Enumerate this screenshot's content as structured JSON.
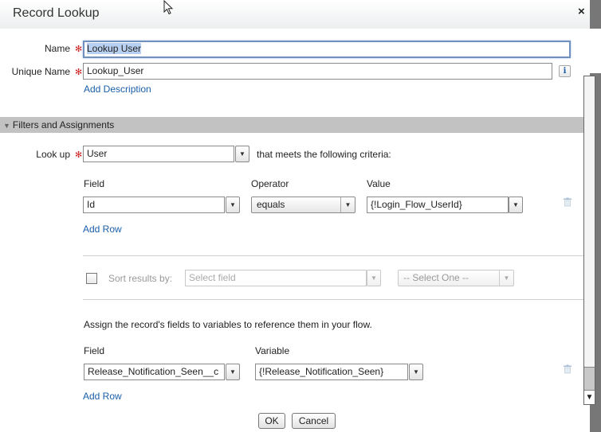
{
  "dialog": {
    "title": "Record Lookup",
    "close_icon": "×"
  },
  "form": {
    "name": {
      "label": "Name",
      "value": "Lookup User",
      "required": true
    },
    "unique_name": {
      "label": "Unique Name",
      "value": "Lookup_User",
      "required": true
    },
    "info_icon": "i",
    "add_description": "Add Description"
  },
  "section": {
    "title": "Filters and Assignments",
    "toggle_icon": "▼"
  },
  "lookup": {
    "label": "Look up",
    "value": "User",
    "suffix": "that meets the following criteria:"
  },
  "filters": {
    "headers": {
      "field": "Field",
      "operator": "Operator",
      "value": "Value"
    },
    "rows": [
      {
        "field": "Id",
        "operator": "equals",
        "value": "{!Login_Flow_UserId}"
      }
    ],
    "add_row": "Add Row"
  },
  "sort": {
    "label": "Sort results by:",
    "field_placeholder": "Select field",
    "order_value": "-- Select One --",
    "checked": false
  },
  "assignments": {
    "intro": "Assign the record's fields to variables to reference them in your flow.",
    "headers": {
      "field": "Field",
      "variable": "Variable"
    },
    "rows": [
      {
        "field": "Release_Notification_Seen__c",
        "variable": "{!Release_Notification_Seen}"
      }
    ],
    "add_row": "Add Row"
  },
  "footer": {
    "ok": "OK",
    "cancel": "Cancel"
  },
  "icons": {
    "dropdown_arrow": "▼"
  }
}
